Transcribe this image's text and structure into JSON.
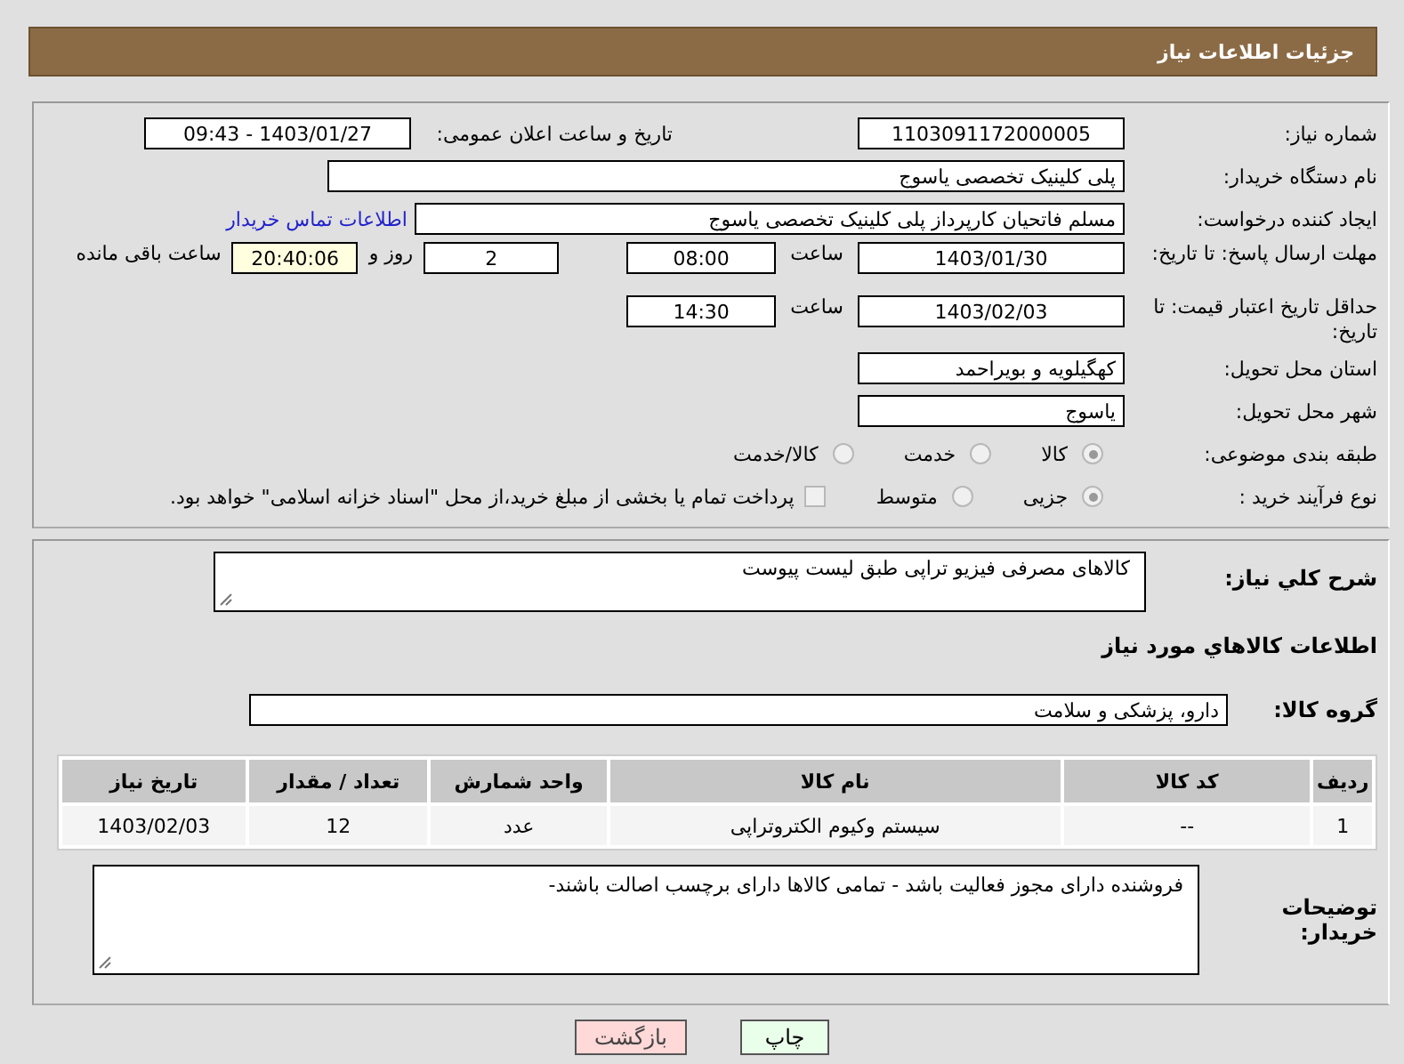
{
  "header": {
    "title": "جزئیات اطلاعات نیاز"
  },
  "need_number": {
    "label": "شماره نیاز:",
    "value": "1103091172000005"
  },
  "announce": {
    "label": "تاریخ و ساعت اعلان عمومی:",
    "value": "1403/01/27 - 09:43"
  },
  "buyer": {
    "label": "نام دستگاه خریدار:",
    "value": "پلی کلینیک تخصصی یاسوج"
  },
  "requester": {
    "label": "ایجاد کننده درخواست:",
    "value": "مسلم فاتحیان کارپرداز  پلی کلینیک تخصصی یاسوج",
    "link": "اطلاعات تماس خریدار"
  },
  "deadline": {
    "label": "مهلت ارسال پاسخ: تا تاریخ:",
    "date": "1403/01/30",
    "time_label": "ساعت",
    "time": "08:00",
    "days": "2",
    "days_label": "روز و",
    "remaining": "20:40:06",
    "remaining_label": "ساعت باقی مانده"
  },
  "validity": {
    "label": "حداقل تاریخ اعتبار قیمت: تا تاریخ:",
    "date": "1403/02/03",
    "time_label": "ساعت",
    "time": "14:30"
  },
  "province": {
    "label": "استان محل تحویل:",
    "value": "کهگیلویه و بویراحمد"
  },
  "city": {
    "label": "شهر محل تحویل:",
    "value": "یاسوج"
  },
  "category": {
    "label": "طبقه بندی موضوعی:",
    "options": [
      {
        "label": "کالا",
        "selected": true
      },
      {
        "label": "خدمت",
        "selected": false
      },
      {
        "label": "کالا/خدمت",
        "selected": false
      }
    ]
  },
  "process": {
    "label": "نوع فرآیند خرید :",
    "options": [
      {
        "label": "جزیی",
        "selected": true
      },
      {
        "label": "متوسط",
        "selected": false
      }
    ],
    "payment": {
      "label": "پرداخت تمام یا بخشی از مبلغ خرید،از محل \"اسناد خزانه اسلامی\" خواهد بود.",
      "checked": false
    }
  },
  "description": {
    "label": "شرح کلي نياز:",
    "value": "کالاهای مصرفی فیزیو تراپی طبق لیست پیوست"
  },
  "goods_title": "اطلاعات کالاهاي مورد نياز",
  "goods_group": {
    "label": "گروه کالا:",
    "value": "دارو، پزشکی و سلامت"
  },
  "table": {
    "columns": [
      "ردیف",
      "کد کالا",
      "نام کالا",
      "واحد شمارش",
      "تعداد / مقدار",
      "تاریخ نیاز"
    ],
    "rows": [
      [
        "1",
        "--",
        "سیستم وکیوم الکتروتراپی",
        "عدد",
        "12",
        "1403/02/03"
      ]
    ]
  },
  "notes": {
    "label": "توضیحات خریدار:",
    "value": "فروشنده دارای مجوز فعالیت باشد - تمامی کالاها دارای برچسب اصالت باشند-"
  },
  "buttons": [
    {
      "label": "چاپ",
      "kind": "print"
    },
    {
      "label": "بازگشت",
      "kind": "back"
    }
  ]
}
